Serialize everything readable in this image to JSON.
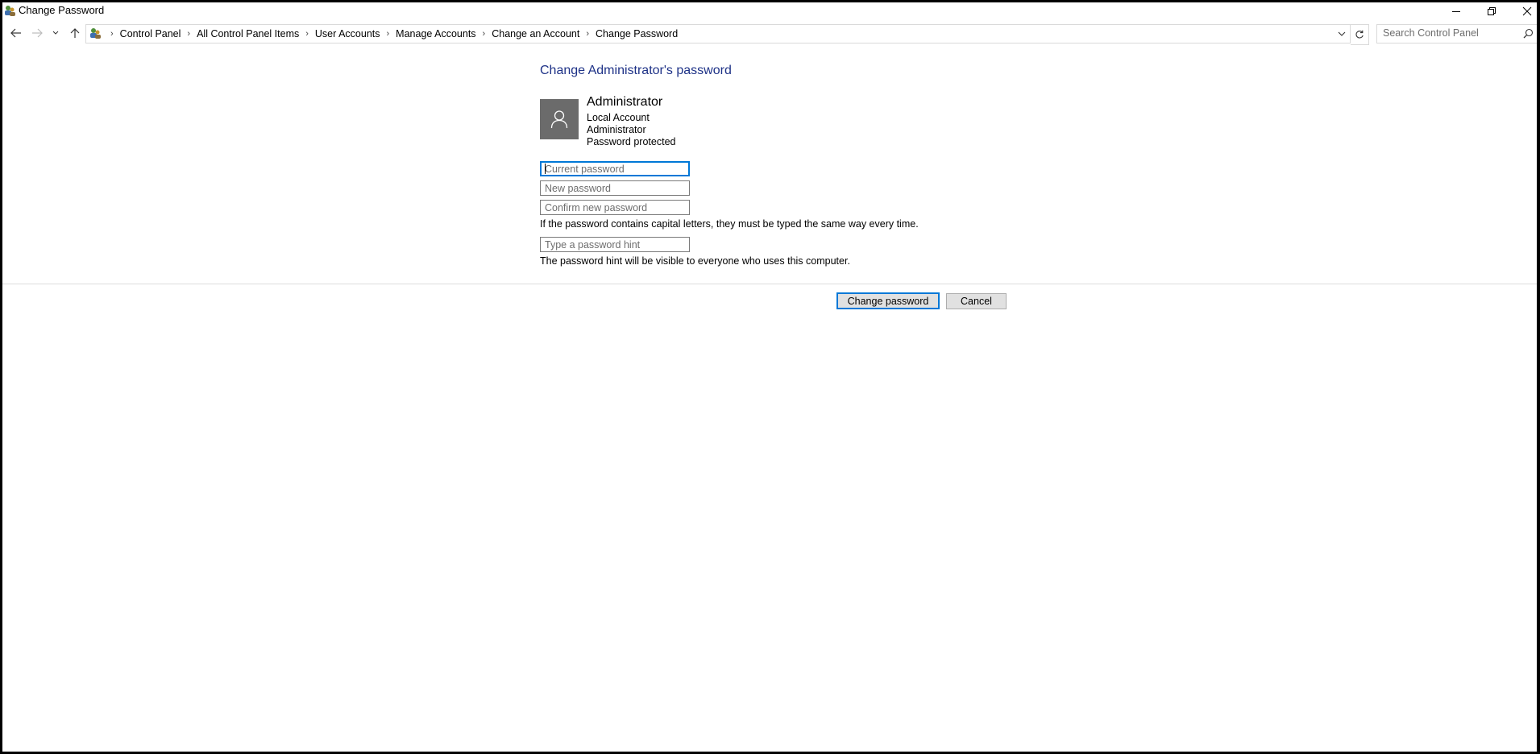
{
  "window": {
    "title": "Change Password",
    "controls": {
      "minimize": "minimize",
      "restore": "restore",
      "close": "close"
    }
  },
  "address_bar": {
    "breadcrumbs": [
      "Control Panel",
      "All Control Panel Items",
      "User Accounts",
      "Manage Accounts",
      "Change an Account",
      "Change Password"
    ]
  },
  "search": {
    "placeholder": "Search Control Panel"
  },
  "page": {
    "heading": "Change Administrator's password",
    "account": {
      "name": "Administrator",
      "type": "Local Account",
      "role": "Administrator",
      "status": "Password protected"
    },
    "fields": {
      "current_placeholder": "Current password",
      "new_placeholder": "New password",
      "confirm_placeholder": "Confirm new password",
      "hint_placeholder": "Type a password hint"
    },
    "notes": {
      "caps": "If the password contains capital letters, they must be typed the same way every time.",
      "hint": "The password hint will be visible to everyone who uses this computer."
    },
    "buttons": {
      "change": "Change password",
      "cancel": "Cancel"
    }
  },
  "colors": {
    "heading": "#1e3287",
    "focus": "#0078d7",
    "avatar_bg": "#6b6b6b"
  }
}
